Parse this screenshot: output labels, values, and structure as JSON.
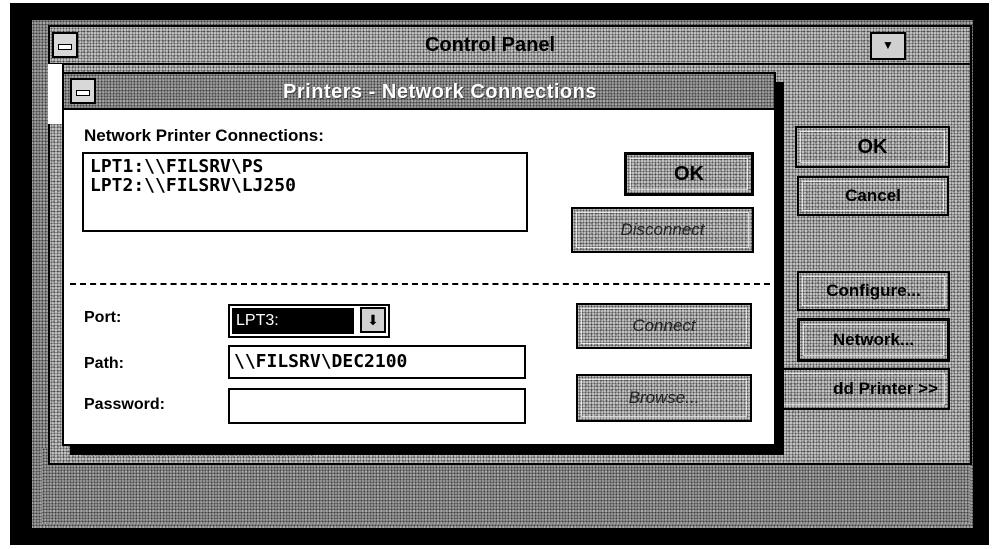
{
  "control_panel": {
    "title": "Control Panel",
    "minimize_glyph": "▼",
    "buttons": {
      "ok": "OK",
      "cancel": "Cancel",
      "configure": "Configure...",
      "network": "Network...",
      "add_printer": "dd Printer >>"
    }
  },
  "dialog": {
    "title": "Printers - Network Connections",
    "connections_label": "Network Printer Connections:",
    "connections": [
      "LPT1:\\\\FILSRV\\PS",
      "LPT2:\\\\FILSRV\\LJ250"
    ],
    "ok_label": "OK",
    "disconnect_label": "Disconnect",
    "connect_label": "Connect",
    "browse_label": "Browse...",
    "port": {
      "label": "Port:",
      "value": "LPT3:",
      "arrow_glyph": "⬇"
    },
    "path": {
      "label": "Path:",
      "value": "\\\\FILSRV\\DEC2100"
    },
    "password": {
      "label": "Password:",
      "value": ""
    }
  }
}
